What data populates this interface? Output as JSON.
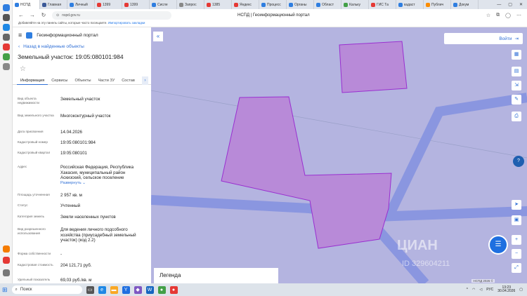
{
  "browser": {
    "tabs": [
      {
        "label": "НСПД",
        "active": true,
        "color": "#2f7ee0"
      },
      {
        "label": "Главная",
        "active": false,
        "color": "#3b5998"
      },
      {
        "label": "Личный",
        "active": false,
        "color": "#2f7ee0"
      },
      {
        "label": "1399",
        "active": false,
        "color": "#e53935"
      },
      {
        "label": "1399",
        "active": false,
        "color": "#e53935"
      },
      {
        "label": "Сисле",
        "active": false,
        "color": "#2f7ee0"
      },
      {
        "label": "Запрос",
        "active": false,
        "color": "#888888"
      },
      {
        "label": "1385",
        "active": false,
        "color": "#e53935"
      },
      {
        "label": "Яндекс",
        "active": false,
        "color": "#e53935"
      },
      {
        "label": "Процесс",
        "active": false,
        "color": "#2f7ee0"
      },
      {
        "label": "Органы",
        "active": false,
        "color": "#2f7ee0"
      },
      {
        "label": "Област",
        "active": false,
        "color": "#2f7ee0"
      },
      {
        "label": "Кальку",
        "active": false,
        "color": "#43a047"
      },
      {
        "label": "ГИС Та",
        "active": false,
        "color": "#e53935"
      },
      {
        "label": "кадаст",
        "active": false,
        "color": "#2f7ee0"
      },
      {
        "label": "Публич",
        "active": false,
        "color": "#fb8c00"
      },
      {
        "label": "Докум",
        "active": false,
        "color": "#2f7ee0"
      }
    ],
    "url": "nspd.gov.ru",
    "page_title": "НСПД | Геоинформационный портал",
    "bookmarks_text": "Добавляйте на эту панель сайты, которые часто посещаете.",
    "bookmarks_link": "Импортировать закладки"
  },
  "panel": {
    "app_title": "Геоинформационный портал",
    "back_label": "Назад в найденные объекты",
    "parcel_title": "Земельный участок: 19:05:080101:984",
    "tabs": [
      "Информация",
      "Сервисы",
      "Объекты",
      "Части ЗУ",
      "Состав"
    ],
    "fields": [
      {
        "label": "Вид объекта недвижимости",
        "value": "Земельный участок"
      },
      {
        "label": "Вид земельного участка",
        "value": "Многоконтурный участок"
      },
      {
        "label": "Дата присвоения",
        "value": "14.04.2026"
      },
      {
        "label": "Кадастровый номер",
        "value": "19:05:080101:984"
      },
      {
        "label": "Кадастровый квартал",
        "value": "19:05:080101"
      },
      {
        "label": "Адрес",
        "value": "Российская Федерация, Республика Хакасия, муниципальный район Аскизский, сельское поселение"
      },
      {
        "label": "Площадь уточненная",
        "value": "2 957 кв. м"
      },
      {
        "label": "Статус",
        "value": "Учтенный"
      },
      {
        "label": "Категория земель",
        "value": "Земли населенных пунктов"
      },
      {
        "label": "Вид разрешенного использования",
        "value": "Для ведения личного подсобного хозяйства (приусадебный земельный участок) (код 2.2)"
      },
      {
        "label": "Форма собственности",
        "value": "-"
      },
      {
        "label": "Кадастровая стоимость",
        "value": "204 121,71 руб."
      },
      {
        "label": "Удельный показатель",
        "value": "69,03 руб./кв. м"
      }
    ],
    "expand_label": "Развернуть"
  },
  "map": {
    "login_label": "Войти",
    "legend_label": "Легенда",
    "watermark": "ЦИАН",
    "watermark_id": "ID 329604211",
    "copyright": "НСПД 2026 ©",
    "bg_color": "#b4b4e0",
    "parcel_fill": "#b88ad8",
    "parcel_stroke": "#9a2fd0",
    "road_color": "#8a96e0"
  },
  "taskbar": {
    "search_label": "Поиск",
    "language": "РУС",
    "time": "13:23",
    "date": "30.04.2026"
  }
}
